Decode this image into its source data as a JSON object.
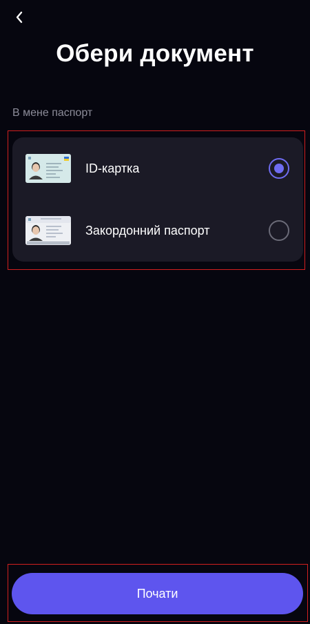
{
  "header": {
    "back_icon": "chevron-left-icon",
    "title": "Обери документ"
  },
  "section_label": "В мене паспорт",
  "options": [
    {
      "label": "ID-картка",
      "icon": "id-card-icon",
      "selected": true
    },
    {
      "label": "Закордонний паспорт",
      "icon": "passport-icon",
      "selected": false
    }
  ],
  "start_button": {
    "label": "Почати"
  },
  "colors": {
    "background": "#06060f",
    "card": "#1b1a26",
    "accent": "#5e55ee",
    "radio_selected": "#6f6cf2",
    "radio_unselected": "#6b6b78",
    "section_label": "#8c8c99"
  }
}
